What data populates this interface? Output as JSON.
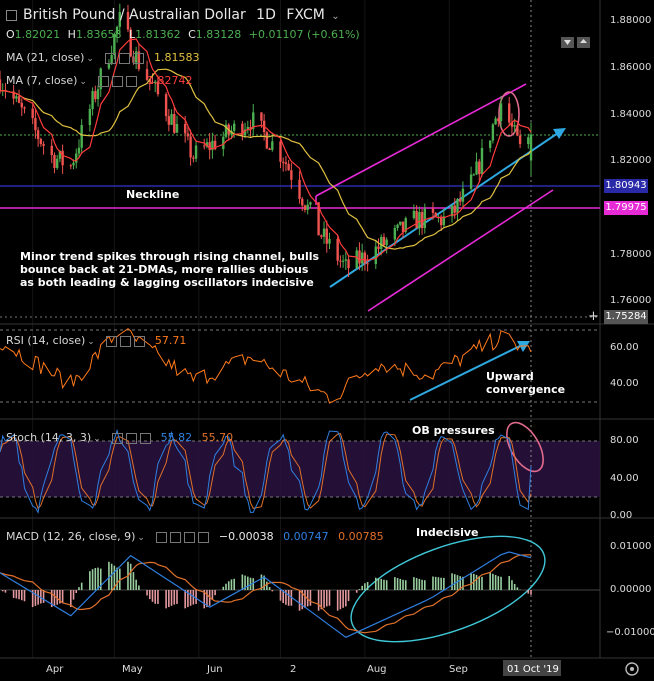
{
  "header": {
    "title": "British Pound / Australian Dollar",
    "interval": "1D",
    "source": "FXCM",
    "open_label": "O",
    "open": "1.82021",
    "high_label": "H",
    "high": "1.83658",
    "low_label": "L",
    "low": "1.81362",
    "close_label": "C",
    "close": "1.83128",
    "change": "+0.01107 (+0.61%)"
  },
  "indicators": {
    "ma21_label": "MA (21, close)",
    "ma21_value": "1.81583",
    "ma7_label": "MA (7, close)",
    "ma7_value": "1.82742",
    "rsi_label": "RSI (14, close)",
    "rsi_value": "57.71",
    "stoch_label": "Stoch (14, 3, 3)",
    "stoch_k": "55.82",
    "stoch_d": "55.70",
    "macd_label": "MACD (12, 26, close, 9)",
    "macd_hist": "−0.00038",
    "macd_line": "0.00747",
    "macd_signal": "0.00785"
  },
  "annotations": {
    "neckline": "Neckline",
    "commentary_1": "Minor trend spikes through rising channel, bulls",
    "commentary_2": "bounce back at 21-DMAs, more rallies dubious",
    "commentary_3": "as both leading & lagging oscillators indecisive",
    "rsi_note_1": "Upward",
    "rsi_note_2": "convergence",
    "stoch_note": "OB pressures",
    "macd_note": "Indecisive"
  },
  "price_axis": {
    "ticks": [
      "1.88000",
      "1.86000",
      "1.84000",
      "1.82000",
      "1.80000",
      "1.78000",
      "1.76000"
    ],
    "tags": [
      {
        "value": "1.80943",
        "color": "#2a2aa8"
      },
      {
        "value": "1.79975",
        "color": "#e62ad6"
      },
      {
        "value": "1.75284",
        "color": "#555555"
      }
    ]
  },
  "rsi_axis": {
    "ticks": [
      "60.00",
      "40.00"
    ]
  },
  "stoch_axis": {
    "ticks": [
      "80.00",
      "40.00",
      "0.00"
    ]
  },
  "macd_axis": {
    "ticks": [
      "0.01000",
      "0.00000",
      "−0.01000"
    ]
  },
  "time_axis": {
    "labels": [
      "Apr",
      "May",
      "Jun",
      "2",
      "Aug",
      "Sep"
    ],
    "current": "01 Oct '19"
  },
  "colors": {
    "bull": "#4caf50",
    "bear": "#ef5350",
    "ma21": "#e0c040",
    "ma7": "#ff3b3b",
    "channel": "#e62ad6",
    "neckline": "#2a2aa8",
    "resistance": "#e62ad6",
    "arrow": "#2ea8e0",
    "rsi": "#ff7a1a",
    "stoch_k": "#2f7fe0",
    "stoch_d": "#e0702a",
    "macd_line": "#2f7fe0",
    "macd_signal": "#e0702a",
    "ellipse_pink": "#e06a8c",
    "ellipse_cyan": "#40c8d8"
  },
  "chart_data": [
    {
      "type": "candlestick",
      "title": "British Pound / Australian Dollar, 1D, FXCM",
      "x_range": [
        "2019-03-20",
        "2019-10-01"
      ],
      "ylim": [
        1.748,
        1.887
      ],
      "key_points": [
        {
          "date": "2019-03-20",
          "close": 1.855
        },
        {
          "date": "2019-04-08",
          "close": 1.822
        },
        {
          "date": "2019-04-15",
          "close": 1.818
        },
        {
          "date": "2019-05-03",
          "close": 1.88
        },
        {
          "date": "2019-05-10",
          "close": 1.862
        },
        {
          "date": "2019-05-30",
          "close": 1.822
        },
        {
          "date": "2019-06-20",
          "close": 1.838
        },
        {
          "date": "2019-07-02",
          "close": 1.822
        },
        {
          "date": "2019-07-15",
          "close": 1.79
        },
        {
          "date": "2019-07-25",
          "close": 1.774
        },
        {
          "date": "2019-08-05",
          "close": 1.782
        },
        {
          "date": "2019-08-20",
          "close": 1.795
        },
        {
          "date": "2019-09-01",
          "close": 1.795
        },
        {
          "date": "2019-09-10",
          "close": 1.812
        },
        {
          "date": "2019-09-20",
          "close": 1.845
        },
        {
          "date": "2019-09-27",
          "close": 1.825
        },
        {
          "date": "2019-10-01",
          "open": 1.82021,
          "high": 1.83658,
          "low": 1.81362,
          "close": 1.83128
        }
      ],
      "moving_averages": [
        {
          "name": "MA (21, close)",
          "last": 1.81583
        },
        {
          "name": "MA (7, close)",
          "last": 1.82742
        }
      ],
      "horizontal_levels": [
        1.80943,
        1.79975,
        1.75284
      ],
      "channel": {
        "upper": [
          [
            "2019-07-08",
            1.8
          ],
          [
            "2019-09-30",
            1.854
          ]
        ],
        "lower": [
          [
            "2019-07-20",
            1.76
          ],
          [
            "2019-10-05",
            1.807
          ]
        ],
        "mid_arrow": [
          [
            "2019-07-15",
            1.77
          ],
          [
            "2019-10-05",
            1.837
          ]
        ]
      }
    },
    {
      "type": "line",
      "title": "RSI (14, close)",
      "last": 57.71,
      "levels": [
        70,
        30
      ],
      "key_points": [
        {
          "date": "2019-03-20",
          "value": 64
        },
        {
          "date": "2019-04-15",
          "value": 40
        },
        {
          "date": "2019-05-03",
          "value": 70
        },
        {
          "date": "2019-05-30",
          "value": 42
        },
        {
          "date": "2019-06-20",
          "value": 55
        },
        {
          "date": "2019-07-20",
          "value": 32
        },
        {
          "date": "2019-08-05",
          "value": 52
        },
        {
          "date": "2019-08-25",
          "value": 45
        },
        {
          "date": "2019-09-20",
          "value": 66
        },
        {
          "date": "2019-10-01",
          "value": 57.71
        }
      ]
    },
    {
      "type": "line",
      "title": "Stoch (14, 3, 3)",
      "series": [
        {
          "name": "%K",
          "last": 55.82
        },
        {
          "name": "%D",
          "last": 55.7
        }
      ],
      "levels": [
        80,
        20
      ],
      "ylim": [
        0,
        100
      ]
    },
    {
      "type": "bar",
      "title": "MACD (12, 26, close, 9)",
      "series": [
        {
          "name": "Histogram",
          "last": -0.00038
        },
        {
          "name": "MACD",
          "last": 0.00747
        },
        {
          "name": "Signal",
          "last": 0.00785
        }
      ],
      "ylim": [
        -0.012,
        0.012
      ],
      "key_points": [
        {
          "date": "2019-03-20",
          "macd": 0.004
        },
        {
          "date": "2019-04-15",
          "macd": -0.006
        },
        {
          "date": "2019-05-07",
          "macd": 0.008
        },
        {
          "date": "2019-06-05",
          "macd": -0.004
        },
        {
          "date": "2019-06-25",
          "macd": 0.003
        },
        {
          "date": "2019-07-25",
          "macd": -0.011
        },
        {
          "date": "2019-08-25",
          "macd": -0.002
        },
        {
          "date": "2019-09-22",
          "macd": 0.009
        },
        {
          "date": "2019-10-01",
          "macd": 0.0075
        }
      ]
    }
  ]
}
